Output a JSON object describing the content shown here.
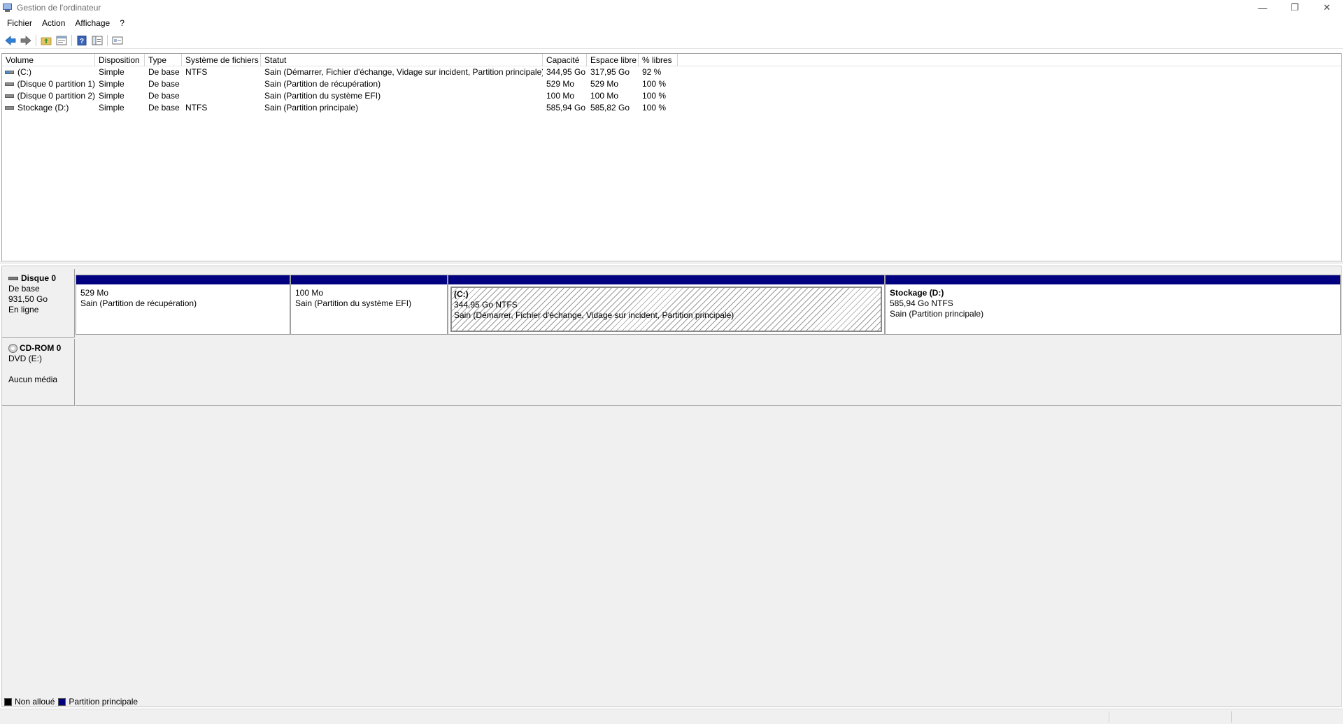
{
  "window": {
    "title": "Gestion de l'ordinateur",
    "controls": {
      "minimize": "—",
      "restore": "❐",
      "close": "✕"
    }
  },
  "menu": [
    "Fichier",
    "Action",
    "Affichage",
    "?"
  ],
  "toolbar": [
    "back-icon",
    "forward-icon",
    "up-folder-icon",
    "properties-icon",
    "help-icon",
    "console-tree-icon",
    "show-hide-icon"
  ],
  "volume_list": {
    "columns": [
      "Volume",
      "Disposition",
      "Type",
      "Système de fichiers",
      "Statut",
      "Capacité",
      "Espace libre",
      "% libres"
    ],
    "rows": [
      {
        "volume": "(C:)",
        "disposition": "Simple",
        "type": "De base",
        "fs": "NTFS",
        "status": "Sain (Démarrer, Fichier d'échange, Vidage sur incident, Partition principale)",
        "capacity": "344,95 Go",
        "free": "317,95 Go",
        "pct": "92 %"
      },
      {
        "volume": "(Disque 0 partition 1)",
        "disposition": "Simple",
        "type": "De base",
        "fs": "",
        "status": "Sain (Partition de récupération)",
        "capacity": "529 Mo",
        "free": "529 Mo",
        "pct": "100 %"
      },
      {
        "volume": "(Disque 0 partition 2)",
        "disposition": "Simple",
        "type": "De base",
        "fs": "",
        "status": "Sain (Partition du système EFI)",
        "capacity": "100 Mo",
        "free": "100 Mo",
        "pct": "100 %"
      },
      {
        "volume": "Stockage (D:)",
        "disposition": "Simple",
        "type": "De base",
        "fs": "NTFS",
        "status": "Sain (Partition principale)",
        "capacity": "585,94 Go",
        "free": "585,82 Go",
        "pct": "100 %"
      }
    ]
  },
  "disks": [
    {
      "name": "Disque 0",
      "kind": "De base",
      "size": "931,50 Go",
      "state": "En ligne",
      "partitions": [
        {
          "title": "",
          "size": "529 Mo",
          "status": "Sain (Partition de récupération)"
        },
        {
          "title": "",
          "size": "100 Mo",
          "status": "Sain (Partition du système EFI)"
        },
        {
          "title": "(C:)",
          "size": "344,95 Go NTFS",
          "status": "Sain (Démarrer, Fichier d'échange, Vidage sur incident, Partition principale)"
        },
        {
          "title": "Stockage  (D:)",
          "size": "585,94 Go NTFS",
          "status": "Sain (Partition principale)"
        }
      ]
    },
    {
      "name": "CD-ROM 0",
      "kind": "DVD (E:)",
      "state": "Aucun média"
    }
  ],
  "legend": [
    {
      "label": "Non alloué",
      "color": "#000000"
    },
    {
      "label": "Partition principale",
      "color": "#000080"
    }
  ]
}
